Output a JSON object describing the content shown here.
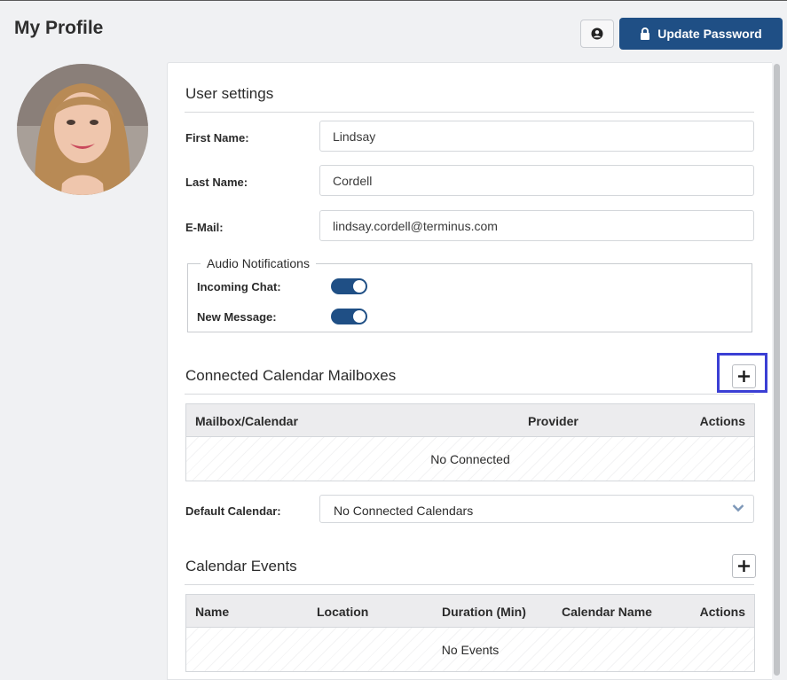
{
  "header": {
    "title": "My Profile",
    "profile_icon": "user-circle-icon",
    "update_password_label": "Update Password",
    "lock_icon": "lock-icon",
    "accent": "#1f4f85"
  },
  "user_settings": {
    "title": "User settings",
    "first_name_label": "First Name:",
    "first_name": "Lindsay",
    "last_name_label": "Last Name:",
    "last_name": "Cordell",
    "email_label": "E-Mail:",
    "email": "lindsay.cordell@terminus.com"
  },
  "audio_notifications": {
    "legend": "Audio Notifications",
    "incoming_chat_label": "Incoming Chat:",
    "incoming_chat_on": true,
    "new_message_label": "New Message:",
    "new_message_on": true
  },
  "mailboxes": {
    "title": "Connected Calendar Mailboxes",
    "add_icon": "plus-icon",
    "columns": [
      "Mailbox/Calendar",
      "Provider",
      "Actions"
    ],
    "empty_text": "No Connected"
  },
  "default_calendar": {
    "label": "Default Calendar:",
    "value": "No Connected Calendars"
  },
  "events": {
    "title": "Calendar Events",
    "add_icon": "plus-icon",
    "columns": [
      "Name",
      "Location",
      "Duration (Min)",
      "Calendar Name",
      "Actions"
    ],
    "empty_text": "No Events"
  }
}
